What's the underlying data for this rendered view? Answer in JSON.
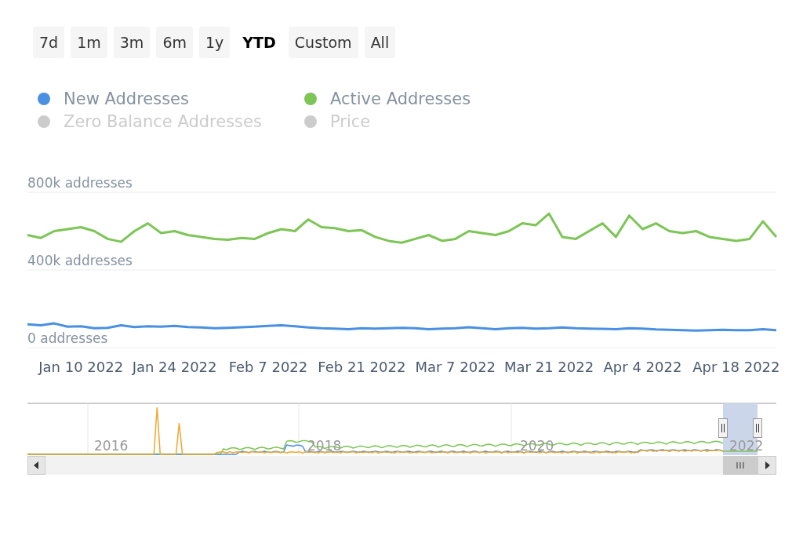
{
  "range_buttons": [
    {
      "label": "7d",
      "selected": false
    },
    {
      "label": "1m",
      "selected": false
    },
    {
      "label": "3m",
      "selected": false
    },
    {
      "label": "6m",
      "selected": false
    },
    {
      "label": "1y",
      "selected": false
    },
    {
      "label": "YTD",
      "selected": true
    },
    {
      "label": "Custom",
      "selected": false
    },
    {
      "label": "All",
      "selected": false
    }
  ],
  "chart": {
    "chart_data": {
      "type": "line",
      "categories": [
        null,
        null,
        null,
        null,
        "Jan 10 2022",
        null,
        null,
        null,
        null,
        null,
        null,
        "Jan 24 2022",
        null,
        null,
        null,
        null,
        null,
        null,
        "Feb 7 2022",
        null,
        null,
        null,
        null,
        null,
        null,
        "Feb 21 2022",
        null,
        null,
        null,
        null,
        null,
        null,
        "Mar 7 2022",
        null,
        null,
        null,
        null,
        null,
        null,
        "Mar 21 2022",
        null,
        null,
        null,
        null,
        null,
        null,
        "Apr 4 2022",
        null,
        null,
        null,
        null,
        null,
        null,
        "Apr 18 2022",
        null,
        null,
        null
      ],
      "ylim": [
        0,
        800000
      ],
      "yticks": [
        {
          "value": 0,
          "label": "0 addresses"
        },
        {
          "value": 400000,
          "label": "400k addresses"
        },
        {
          "value": 800000,
          "label": "800k addresses"
        }
      ],
      "series": [
        {
          "name": "New Addresses",
          "color": "#4a90e2",
          "values": [
            120000,
            115000,
            125000,
            108000,
            110000,
            100000,
            102000,
            115000,
            106000,
            110000,
            108000,
            112000,
            106000,
            104000,
            100000,
            102000,
            105000,
            108000,
            112000,
            115000,
            110000,
            104000,
            100000,
            98000,
            95000,
            100000,
            98000,
            100000,
            102000,
            100000,
            95000,
            98000,
            100000,
            105000,
            100000,
            95000,
            100000,
            102000,
            98000,
            100000,
            104000,
            100000,
            98000,
            97000,
            95000,
            100000,
            98000,
            94000,
            92000,
            90000,
            88000,
            90000,
            92000,
            90000,
            90000,
            95000,
            90000
          ]
        },
        {
          "name": "Active Addresses",
          "color": "#7cc556",
          "values": [
            580000,
            565000,
            600000,
            610000,
            620000,
            600000,
            560000,
            545000,
            600000,
            640000,
            590000,
            600000,
            580000,
            570000,
            560000,
            555000,
            565000,
            560000,
            590000,
            610000,
            600000,
            660000,
            620000,
            615000,
            600000,
            605000,
            570000,
            550000,
            540000,
            560000,
            580000,
            550000,
            560000,
            600000,
            590000,
            580000,
            600000,
            640000,
            630000,
            690000,
            570000,
            560000,
            600000,
            640000,
            570000,
            680000,
            610000,
            640000,
            600000,
            590000,
            600000,
            570000,
            560000,
            550000,
            560000,
            650000,
            570000
          ]
        }
      ]
    }
  },
  "legend": [
    {
      "visible": true
    },
    {
      "visible": true
    },
    {
      "name": "Zero Balance Addresses",
      "visible": false
    },
    {
      "name": "Price",
      "visible": false
    }
  ],
  "navigator": {
    "year_labels": [
      "2016",
      "2018",
      "2020",
      "2022"
    ]
  }
}
